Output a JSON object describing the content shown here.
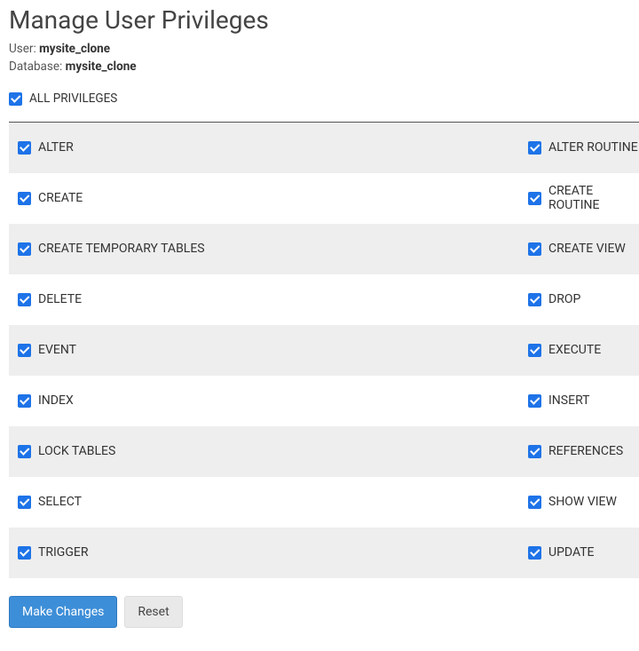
{
  "header": {
    "title": "Manage User Privileges",
    "user_label": "User:",
    "user_value": "mysite_clone",
    "database_label": "Database:",
    "database_value": "mysite_clone"
  },
  "all_privileges": {
    "label": "ALL PRIVILEGES",
    "checked": true
  },
  "privileges": [
    {
      "left": "ALTER",
      "right": "ALTER ROUTINE"
    },
    {
      "left": "CREATE",
      "right": "CREATE ROUTINE"
    },
    {
      "left": "CREATE TEMPORARY TABLES",
      "right": "CREATE VIEW"
    },
    {
      "left": "DELETE",
      "right": "DROP"
    },
    {
      "left": "EVENT",
      "right": "EXECUTE"
    },
    {
      "left": "INDEX",
      "right": "INSERT"
    },
    {
      "left": "LOCK TABLES",
      "right": "REFERENCES"
    },
    {
      "left": "SELECT",
      "right": "SHOW VIEW"
    },
    {
      "left": "TRIGGER",
      "right": "UPDATE"
    }
  ],
  "buttons": {
    "primary": "Make Changes",
    "secondary": "Reset"
  }
}
